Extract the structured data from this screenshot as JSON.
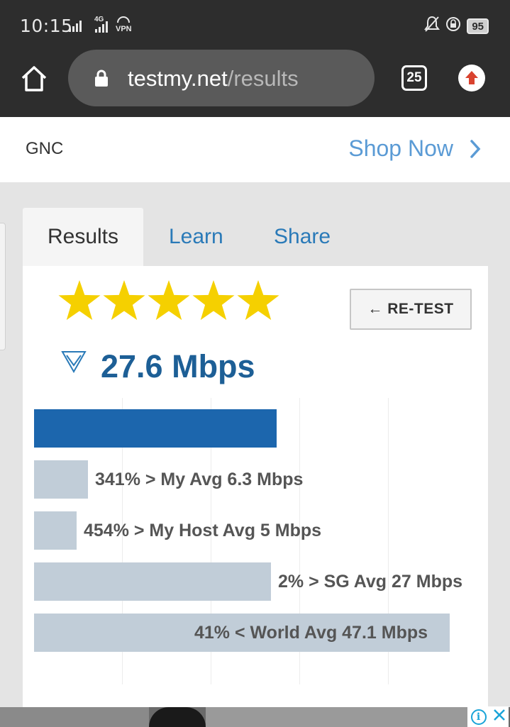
{
  "status_bar": {
    "time": "10:15",
    "network": "4G",
    "vpn": "VPN",
    "battery": "95"
  },
  "browser": {
    "url_host": "testmy.net",
    "url_path": "/results",
    "tab_count": "25"
  },
  "ad": {
    "brand": "GNC",
    "cta": "Shop Now"
  },
  "tabs": [
    {
      "label": "Results",
      "active": true
    },
    {
      "label": "Learn"
    },
    {
      "label": "Share"
    }
  ],
  "result": {
    "rating_stars": 5,
    "retest_label": "← RE-TEST",
    "speed": "27.6 Mbps",
    "comparisons": [
      {
        "label": "341% > My Avg 6.3 Mbps",
        "value_mbps": 6.3
      },
      {
        "label": "454% > My Host Avg 5 Mbps",
        "value_mbps": 5
      },
      {
        "label": "2% > SG Avg 27 Mbps",
        "value_mbps": 27
      },
      {
        "label": "41% < World Avg 47.1 Mbps",
        "value_mbps": 47.1
      }
    ],
    "colors": {
      "main_bar": "#1c66ad",
      "compare_bar": "#c1cdd8",
      "speed_text": "#1d5f96",
      "star": "#f5d000"
    }
  }
}
